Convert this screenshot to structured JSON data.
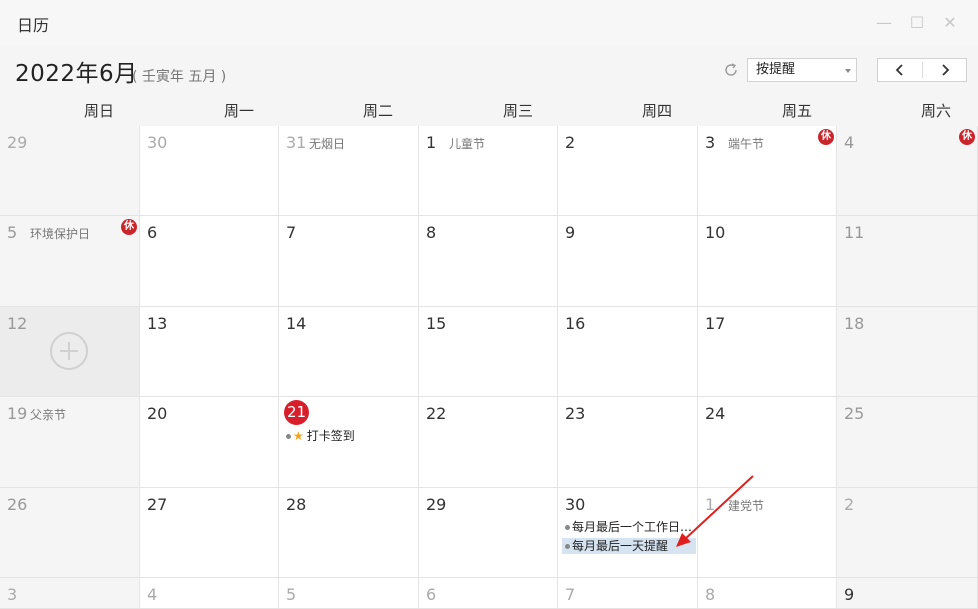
{
  "window": {
    "title": "日历"
  },
  "header": {
    "month_title": "2022年6月",
    "lunar_text": "( 壬寅年 五月 )",
    "view_select": "按提醒"
  },
  "weekdays": [
    "周日",
    "周一",
    "周二",
    "周三",
    "周四",
    "周五",
    "周六"
  ],
  "weeks": [
    [
      {
        "day": "29",
        "other": true
      },
      {
        "day": "30",
        "other": true
      },
      {
        "day": "31",
        "other": true,
        "holiday": "无烟日"
      },
      {
        "day": "1",
        "holiday": "儿童节"
      },
      {
        "day": "2"
      },
      {
        "day": "3",
        "holiday": "端午节",
        "rest": "休"
      },
      {
        "day": "4",
        "rest": "休",
        "dim": true
      }
    ],
    [
      {
        "day": "5",
        "holiday": "环境保护日",
        "rest": "休",
        "dim": true
      },
      {
        "day": "6"
      },
      {
        "day": "7"
      },
      {
        "day": "8"
      },
      {
        "day": "9"
      },
      {
        "day": "10"
      },
      {
        "day": "11",
        "dim": true
      }
    ],
    [
      {
        "day": "12",
        "dim": true,
        "selected": true
      },
      {
        "day": "13"
      },
      {
        "day": "14"
      },
      {
        "day": "15"
      },
      {
        "day": "16"
      },
      {
        "day": "17"
      },
      {
        "day": "18",
        "dim": true
      }
    ],
    [
      {
        "day": "19",
        "holiday": "父亲节",
        "dim": true
      },
      {
        "day": "20"
      },
      {
        "day": "21",
        "today": true,
        "events": [
          {
            "text": "打卡签到",
            "star": true
          }
        ]
      },
      {
        "day": "22"
      },
      {
        "day": "23"
      },
      {
        "day": "24"
      },
      {
        "day": "25",
        "dim": true
      }
    ],
    [
      {
        "day": "26",
        "dim": true
      },
      {
        "day": "27"
      },
      {
        "day": "28"
      },
      {
        "day": "29"
      },
      {
        "day": "30",
        "events": [
          {
            "text": "每月最后一个工作日…"
          },
          {
            "text": "每月最后一天提醒",
            "selected": true
          }
        ]
      },
      {
        "day": "1",
        "other": true,
        "holiday": "建党节"
      },
      {
        "day": "2",
        "other": true
      }
    ],
    [
      {
        "day": "3",
        "other": true
      },
      {
        "day": "4",
        "other": true
      },
      {
        "day": "5",
        "other": true
      },
      {
        "day": "6",
        "other": true
      },
      {
        "day": "7",
        "other": true
      },
      {
        "day": "8",
        "other": true
      },
      {
        "day": "9"
      }
    ]
  ],
  "colors": {
    "today": "#d81e2a",
    "rest_badge": "#c9252b",
    "selected_event": "#d6e4f2",
    "annotation_arrow": "#e0201e"
  },
  "icons": [
    "minimize-icon",
    "maximize-icon",
    "close-icon",
    "refresh-icon",
    "chevron-down-icon",
    "chevron-left-icon",
    "chevron-right-icon",
    "add-icon",
    "star-icon"
  ]
}
